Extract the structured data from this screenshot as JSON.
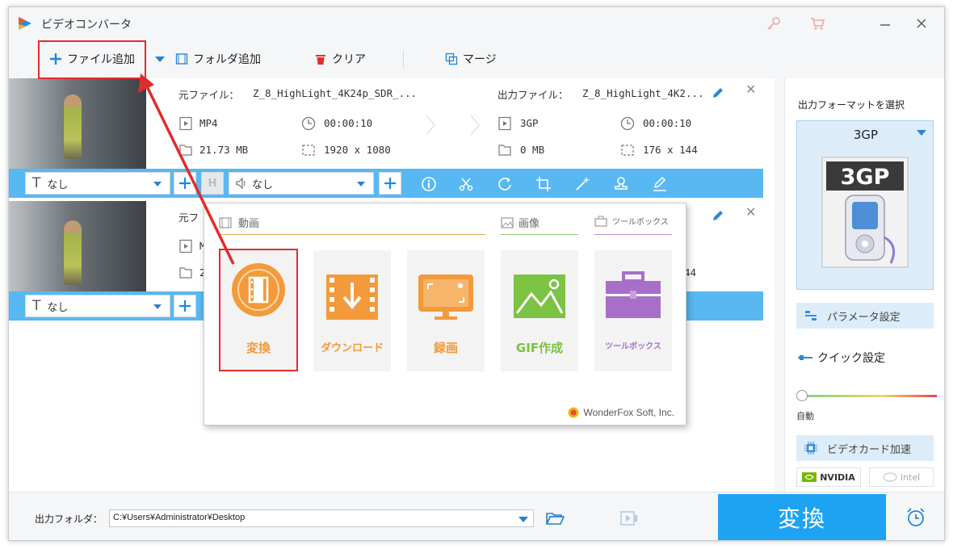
{
  "window": {
    "title": "ビデオコンバータ"
  },
  "toolbar": {
    "add_file": "ファイル追加",
    "add_folder": "フォルダ追加",
    "clear": "クリア",
    "merge": "マージ"
  },
  "tasks": [
    {
      "source_label": "元ファイル：",
      "source_name": "Z_8_HighLight_4K24p_SDR_...",
      "output_label": "出力ファイル：",
      "output_name": "Z_8_HighLight_4K2...",
      "src_format": "MP4",
      "src_duration": "00:00:10",
      "src_size": "21.73 MB",
      "src_resolution": "1920 x 1080",
      "out_format": "3GP",
      "out_duration": "00:00:10",
      "out_size": "0 MB",
      "out_resolution": "176 x 144",
      "subtitle": "なし",
      "audio": "なし"
    },
    {
      "source_label": "元フ",
      "src_format_partial": "M",
      "src_size_partial": "2",
      "out_res_partial": "44",
      "subtitle": "なし"
    }
  ],
  "popup": {
    "section_video": "動画",
    "section_image": "画像",
    "section_tools": "ツールボックス",
    "tiles": [
      {
        "label": "変換",
        "color": "#f39a3b"
      },
      {
        "label": "ダウンロード",
        "color": "#f39a3b"
      },
      {
        "label": "録画",
        "color": "#f39a3b"
      },
      {
        "label": "GIF作成",
        "color": "#7cc243"
      },
      {
        "label": "ツールボックス",
        "color": "#a86fc9"
      }
    ],
    "brand": "WonderFox Soft, Inc."
  },
  "right_panel": {
    "title": "出力フォーマットを選択",
    "format": "3GP",
    "format_badge": "3GP",
    "param_settings": "パラメータ設定",
    "quick_settings": "クイック設定",
    "auto_label": "自動",
    "gpu_accel": "ビデオカード加速",
    "nvidia": "NVIDIA",
    "intel": "Intel"
  },
  "bottom": {
    "output_folder_label": "出力フォルダ：",
    "output_path": "C:¥Users¥Administrator¥Desktop",
    "convert": "変換"
  },
  "colors": {
    "accent": "#1ea2f2",
    "bar": "#58b8f2",
    "highlight": "#e12c2c"
  }
}
